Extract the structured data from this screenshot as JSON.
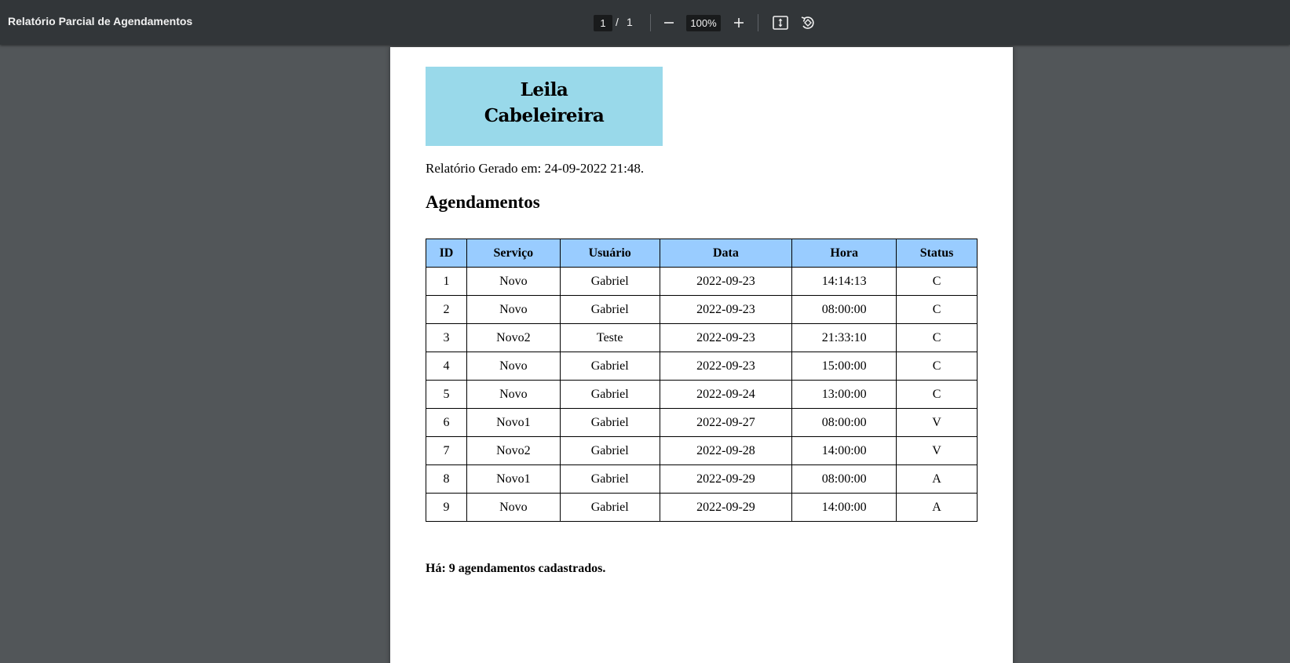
{
  "viewer": {
    "title": "Relatório Parcial de Agendamentos",
    "current_page": "1",
    "page_separator": "/",
    "total_pages": "1",
    "zoom": "100%",
    "icons": [
      "zoom-out-icon",
      "zoom-in-icon",
      "fit-page-icon",
      "rotate-icon"
    ]
  },
  "document": {
    "logo": {
      "line1": "Leila",
      "line2": "Cabeleireira",
      "background": "#99d9ea"
    },
    "generated_text": "Relatório Gerado em: 24-09-2022 21:48.",
    "section_title": "Agendamentos",
    "table": {
      "header_color": "#99ccff",
      "headers": [
        "ID",
        "Serviço",
        "Usuário",
        "Data",
        "Hora",
        "Status"
      ],
      "rows": [
        [
          "1",
          "Novo",
          "Gabriel",
          "2022-09-23",
          "14:14:13",
          "C"
        ],
        [
          "2",
          "Novo",
          "Gabriel",
          "2022-09-23",
          "08:00:00",
          "C"
        ],
        [
          "3",
          "Novo2",
          "Teste",
          "2022-09-23",
          "21:33:10",
          "C"
        ],
        [
          "4",
          "Novo",
          "Gabriel",
          "2022-09-23",
          "15:00:00",
          "C"
        ],
        [
          "5",
          "Novo",
          "Gabriel",
          "2022-09-24",
          "13:00:00",
          "C"
        ],
        [
          "6",
          "Novo1",
          "Gabriel",
          "2022-09-27",
          "08:00:00",
          "V"
        ],
        [
          "7",
          "Novo2",
          "Gabriel",
          "2022-09-28",
          "14:00:00",
          "V"
        ],
        [
          "8",
          "Novo1",
          "Gabriel",
          "2022-09-29",
          "08:00:00",
          "A"
        ],
        [
          "9",
          "Novo",
          "Gabriel",
          "2022-09-29",
          "14:00:00",
          "A"
        ]
      ]
    },
    "summary": "Há: 9 agendamentos cadastrados."
  }
}
